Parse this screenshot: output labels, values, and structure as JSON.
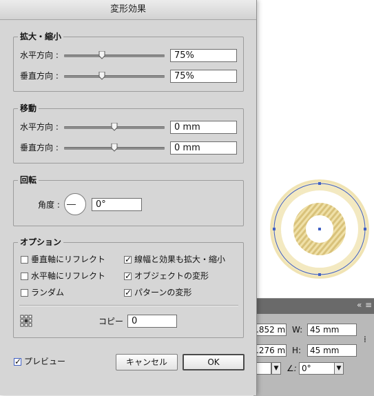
{
  "dialog": {
    "title": "変形効果",
    "scale": {
      "title": "拡大・縮小",
      "horizontal_label": "水平方向 :",
      "horizontal_value": "75%",
      "horizontal_slider": 0.37,
      "vertical_label": "垂直方向 :",
      "vertical_value": "75%",
      "vertical_slider": 0.37
    },
    "move": {
      "title": "移動",
      "horizontal_label": "水平方向 :",
      "horizontal_value": "0 mm",
      "horizontal_slider": 0.5,
      "vertical_label": "垂直方向 :",
      "vertical_value": "0 mm",
      "vertical_slider": 0.5
    },
    "rotate": {
      "title": "回転",
      "angle_label": "角度 :",
      "angle_value": "0°"
    },
    "options": {
      "title": "オプション",
      "reflect_vertical": {
        "label": "垂直軸にリフレクト",
        "checked": false
      },
      "reflect_horizontal": {
        "label": "水平軸にリフレクト",
        "checked": false
      },
      "random": {
        "label": "ランダム",
        "checked": false
      },
      "scale_strokes": {
        "label": "線幅と効果も拡大・縮小",
        "checked": true
      },
      "transform_objects": {
        "label": "オブジェクトの変形",
        "checked": true
      },
      "transform_patterns": {
        "label": "パターンの変形",
        "checked": true
      },
      "copy_label": "コピー",
      "copy_value": "0"
    },
    "preview": {
      "label": "プレビュー",
      "checked": true
    },
    "cancel_label": "キャンセル",
    "ok_label": "OK"
  },
  "panel": {
    "x_value": ".852 m",
    "y_value": ".276 m",
    "w_label": "W:",
    "w_value": "45 mm",
    "h_label": "H:",
    "h_value": "45 mm",
    "shear_value": "0°"
  },
  "colors": {
    "dialog_bg": "#d6d6d6",
    "selection_blue": "#3f5fc4",
    "ring_gold": "#e9d79a",
    "guide_red": "#c8302c"
  }
}
